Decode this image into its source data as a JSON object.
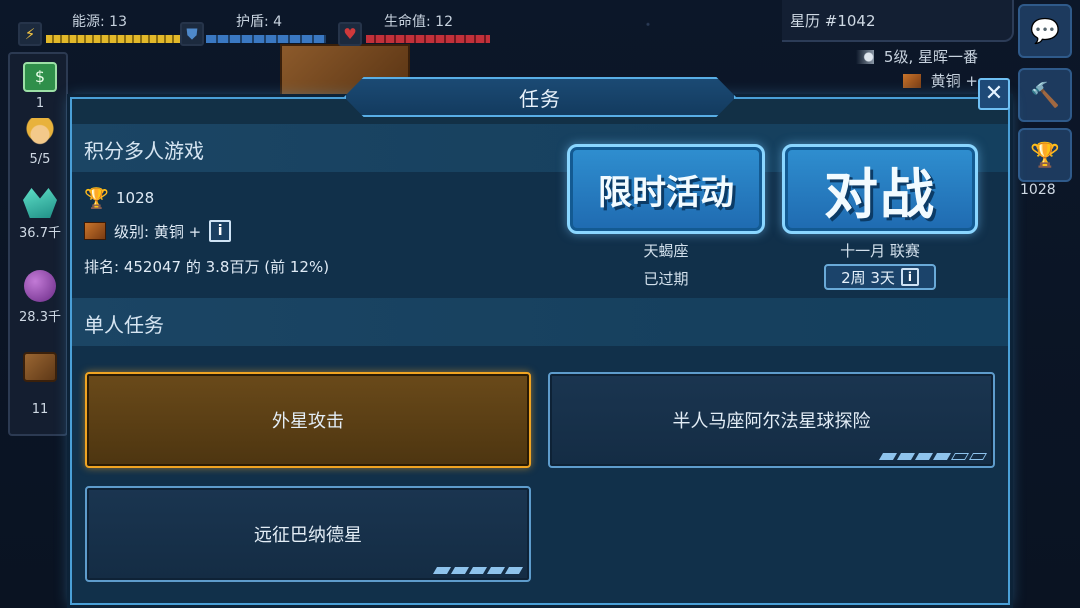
{
  "hud": {
    "energy": {
      "label": "能源: 13",
      "icon": "lightning-icon"
    },
    "shield": {
      "label": "护盾: 4",
      "icon": "shield-icon"
    },
    "health": {
      "label": "生命值: 12",
      "icon": "heart-icon"
    },
    "stardate": "星历 #1042",
    "player_rank": "5级, 星晖一番",
    "player_league": "黄铜 +"
  },
  "resources": [
    {
      "name": "money",
      "icon": "money-icon",
      "value": "1"
    },
    {
      "name": "crew",
      "icon": "crew-icon",
      "value": "5/5"
    },
    {
      "name": "crystals",
      "icon": "crystal-icon",
      "value": "36.7千"
    },
    {
      "name": "planet",
      "icon": "planet-icon",
      "value": "28.3千"
    },
    {
      "name": "cargo",
      "icon": "crate-icon",
      "value": "11"
    }
  ],
  "right_rail": {
    "chat_icon": "chat-icon",
    "build_icon": "hammer-icon",
    "trophy_icon": "trophy-icon",
    "trophy_value": "1028"
  },
  "dialog": {
    "title": "任务",
    "close_icon": "close-icon",
    "multi": {
      "heading": "积分多人游戏",
      "trophies": "1028",
      "league": "级别: 黄铜 +",
      "rank": "排名: 452047 的 3.8百万 (前 12%)"
    },
    "event_button": {
      "label": "限时活动",
      "line1": "天蝎座",
      "line2": "已过期"
    },
    "battle_button": {
      "label": "对战",
      "line1": "十一月 联赛",
      "timer": "2周 3天"
    },
    "single": {
      "heading": "单人任务",
      "missions": [
        {
          "name": "外星攻击",
          "state": "selected"
        },
        {
          "name": "半人马座阿尔法星球探险",
          "progress_filled": 4,
          "progress_total": 6
        },
        {
          "name": "远征巴纳德星",
          "progress_filled": 5,
          "progress_total": 5
        }
      ]
    }
  },
  "colors": {
    "panel": "#123046",
    "accent": "#4aa0d8",
    "active_mission": "#f0a422"
  }
}
